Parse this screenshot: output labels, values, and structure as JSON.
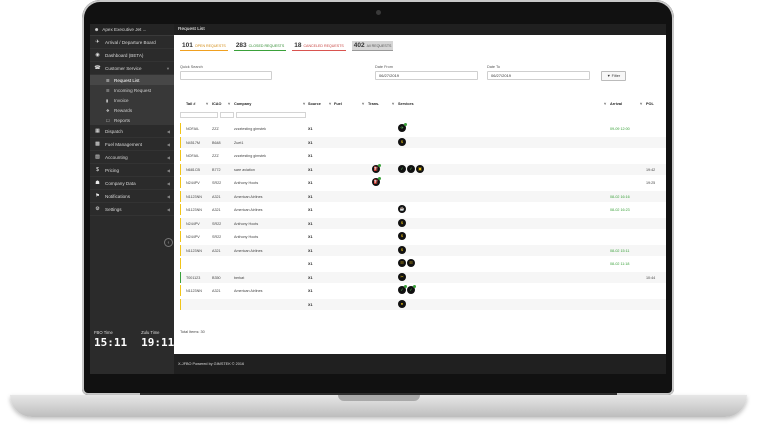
{
  "sidebar": {
    "user": "Apex Executive Jet ...",
    "items": [
      {
        "label": "Arrival / Departure Board",
        "icon": "plane-icon"
      },
      {
        "label": "Dashboard (BETA)",
        "icon": "dashboard-icon"
      },
      {
        "label": "Customer Service",
        "icon": "phone-icon"
      }
    ],
    "sub_items": [
      {
        "label": "Request List",
        "icon": "list-icon"
      },
      {
        "label": "Incoming Request",
        "icon": "list-icon"
      },
      {
        "label": "Invoice",
        "icon": "file-icon"
      },
      {
        "label": "Rewards",
        "icon": "reward-icon"
      },
      {
        "label": "Reports",
        "icon": "report-icon"
      }
    ],
    "items2": [
      {
        "label": "Dispatch",
        "icon": "calendar-icon"
      },
      {
        "label": "Fuel Management",
        "icon": "fuel-icon"
      },
      {
        "label": "Accounting",
        "icon": "accounting-icon"
      },
      {
        "label": "Pricing",
        "icon": "dollar-icon"
      },
      {
        "label": "Company Data",
        "icon": "company-icon"
      },
      {
        "label": "Notifications",
        "icon": "flag-icon"
      },
      {
        "label": "Settings",
        "icon": "gear-icon"
      }
    ],
    "fbo_time_label": "FBO Time",
    "fbo_time": "15:11",
    "zulu_time_label": "Zulu Time",
    "zulu_time": "19:11"
  },
  "header": {
    "title": "Request List"
  },
  "counts": {
    "open_num": "101",
    "open_label": "OPEN REQUESTS",
    "closed_num": "283",
    "closed_label": "CLOSED REQUESTS",
    "cancel_num": "18",
    "cancel_label": "CANCELED REQUESTS",
    "all_num": "402",
    "all_label": "All REQUESTS"
  },
  "filters": {
    "quick_search_label": "Quick Search",
    "date_from_label": "Date From",
    "date_from_value": "06/27/2019",
    "date_to_label": "Date To",
    "date_to_value": "06/27/2019",
    "filter_button": "Filter"
  },
  "columns": [
    "Tail #",
    "ICAO",
    "Company",
    "Source",
    "Fuel",
    "Trans.",
    "Services",
    "Arrival",
    "POL"
  ],
  "rows": [
    {
      "tail": "NOFAIL",
      "icao": "ZZZ",
      "company": "zzzztesting gimstek",
      "source": "X1",
      "arrival": "09-09 12:00",
      "pol": ""
    },
    {
      "tail": "N4517M",
      "icao": "B648",
      "company": "Zuet1",
      "source": "X1",
      "arrival": "",
      "pol": ""
    },
    {
      "tail": "NOFAIL",
      "icao": "ZZZ",
      "company": "zzzztesting gimstek",
      "source": "X1",
      "arrival": "",
      "pol": ""
    },
    {
      "tail": "N681CB",
      "icao": "B772",
      "company": "sare aviation",
      "source": "X1",
      "arrival": "",
      "pol": "19:42"
    },
    {
      "tail": "N244PV",
      "icao": "SR22",
      "company": "Anthony Hoots",
      "source": "X1",
      "arrival": "",
      "pol": "19:25"
    },
    {
      "tail": "N1123NN",
      "icao": "A321",
      "company": "American Airlines",
      "source": "X1",
      "arrival": "08-02 16:16",
      "pol": ""
    },
    {
      "tail": "N1123NN",
      "icao": "A321",
      "company": "American Airlines",
      "source": "X1",
      "arrival": "08-02 16:23",
      "pol": ""
    },
    {
      "tail": "N244PV",
      "icao": "SR22",
      "company": "Anthony Hoots",
      "source": "X1",
      "arrival": "",
      "pol": ""
    },
    {
      "tail": "N244PV",
      "icao": "SR22",
      "company": "Anthony Hoots",
      "source": "X1",
      "arrival": "",
      "pol": ""
    },
    {
      "tail": "N1123NN",
      "icao": "A321",
      "company": "American Airlines",
      "source": "X1",
      "arrival": "08-02 15:11",
      "pol": ""
    },
    {
      "tail": "",
      "icao": "",
      "company": "",
      "source": "X1",
      "arrival": "08-02 11:18",
      "pol": ""
    },
    {
      "tail": "T001123",
      "icao": "B350",
      "company": "berkat",
      "source": "X1",
      "arrival": "",
      "pol": "10:44"
    },
    {
      "tail": "N1123NN",
      "icao": "A321",
      "company": "American Airlines",
      "source": "X1",
      "arrival": "",
      "pol": ""
    },
    {
      "tail": "",
      "icao": "",
      "company": "",
      "source": "X1",
      "arrival": "",
      "pol": ""
    }
  ],
  "total_label": "Total Items: 30",
  "footer": "X-JFBO Powered by GIMSTEK © 2016",
  "colors": {
    "accent_yellow": "#f0c419",
    "accent_green": "#3aa13a",
    "sidebar": "#2b2b2b"
  }
}
